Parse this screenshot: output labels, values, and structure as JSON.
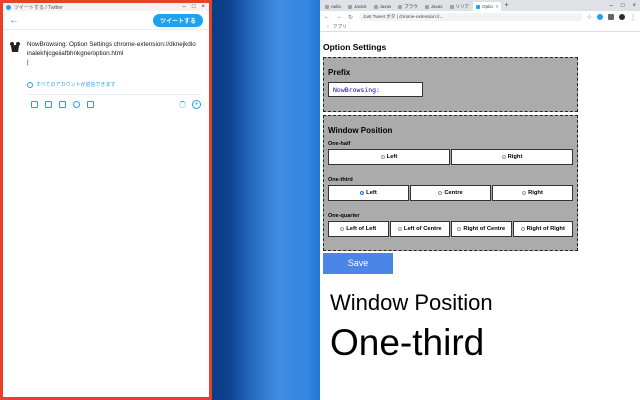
{
  "twitter": {
    "title": "ツイートする / Twitter",
    "tweet_button": "ツイートする",
    "compose_text": "NowBrowsing: Option Settings chrome-extension://dknejkdloinalekhjcgeiiafbhnkgne/option.html",
    "cursor": "|",
    "reply_setting": "すべてのアカウントが返信できます"
  },
  "browser": {
    "tabs": [
      {
        "label": "radio"
      },
      {
        "label": "JavaS"
      },
      {
        "label": "Javas"
      },
      {
        "label": "ブラウ"
      },
      {
        "label": "Javas"
      },
      {
        "label": "リリア"
      },
      {
        "label": "Optio"
      }
    ],
    "omnibox": "Just Tweet ボタ | chrome-extension://...",
    "bookmarks_label": "アプリ"
  },
  "options": {
    "title": "Option Settings",
    "prefix": {
      "title": "Prefix",
      "value": "NowBrowsing:"
    },
    "position": {
      "title": "Window Position",
      "groups": [
        {
          "label": "One-half",
          "options": [
            "Left",
            "Right"
          ],
          "selected": ""
        },
        {
          "label": "One-third",
          "options": [
            "Left",
            "Centre",
            "Right"
          ],
          "selected": "Left"
        },
        {
          "label": "One-quarter",
          "options": [
            "Left of Left",
            "Left of Centre",
            "Right of Centre",
            "Right of Right"
          ],
          "selected": ""
        }
      ]
    },
    "save_label": "Save"
  },
  "caption": {
    "line1": "Window Position",
    "line2": "One-third"
  },
  "colors": {
    "twitter_blue": "#1da1f2",
    "window_border": "#e8412a",
    "panel_gray": "#ababab",
    "save_blue": "#4a86e8"
  }
}
